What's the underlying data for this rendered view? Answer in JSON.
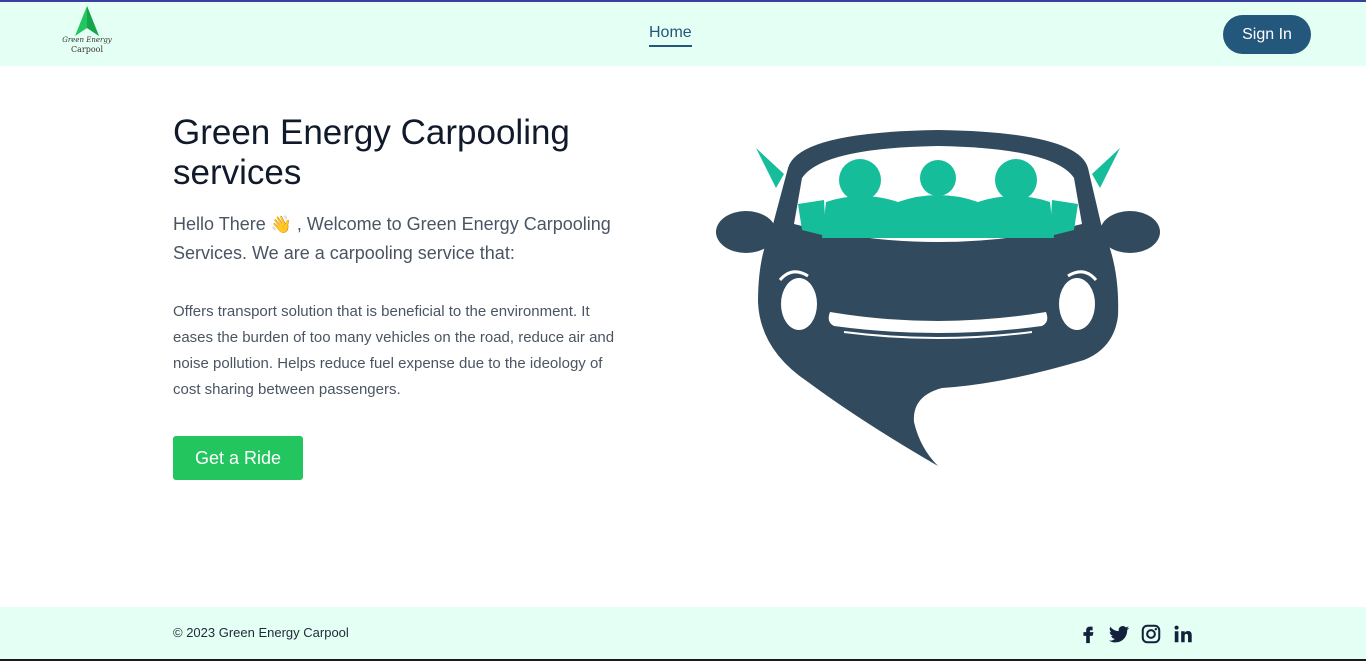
{
  "header": {
    "logo": {
      "line1": "Green Energy",
      "line2": "Carpool"
    },
    "nav": {
      "home_label": "Home"
    },
    "signin_label": "Sign In"
  },
  "hero": {
    "title": "Green Energy Carpooling services",
    "welcome_prefix": "Hello There",
    "welcome_emoji": "👋",
    "welcome_suffix": ", Welcome to Green Energy Carpooling Services. We are a carpooling service that:",
    "description": "Offers transport solution that is beneficial to the environment. It eases the burden of too many vehicles on the road, reduce air and noise pollution. Helps reduce fuel expense due to the ideology of cost sharing between passengers.",
    "cta_label": "Get a Ride"
  },
  "footer": {
    "copyright": "© 2023 Green Energy Carpool",
    "social": [
      {
        "icon": "facebook-icon"
      },
      {
        "icon": "twitter-icon"
      },
      {
        "icon": "instagram-icon"
      },
      {
        "icon": "linkedin-icon"
      }
    ]
  },
  "colors": {
    "header_bg": "#e4fff4",
    "primary": "#23577c",
    "accent_green": "#22c55e",
    "car_body": "#324a5e",
    "passengers": "#16bd9a"
  }
}
